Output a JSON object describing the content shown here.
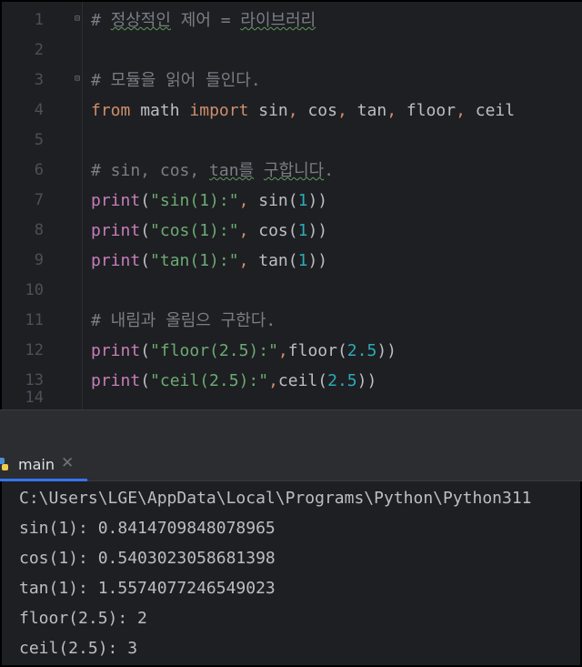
{
  "editor": {
    "lines": [
      {
        "n": "1",
        "html": "<span class=\"cmt\"># <span class=\"typo\">정상적인</span> 제어 = <span class=\"typo\">라이브러리</span></span>"
      },
      {
        "n": "2",
        "html": ""
      },
      {
        "n": "3",
        "html": "<span class=\"cmt\"># 모듈을 읽어 들인다.</span>"
      },
      {
        "n": "4",
        "html": "<span class=\"kw\">from</span> math <span class=\"kw\">import</span> sin<span class=\"punc\">,</span> cos<span class=\"punc\">,</span> tan<span class=\"punc\">,</span> floor<span class=\"punc\">,</span> ceil"
      },
      {
        "n": "5",
        "html": ""
      },
      {
        "n": "6",
        "html": "<span class=\"cmt\"># sin, cos, <span class=\"typo\">tan를</span> <span class=\"typo\">구합니다</span>.</span>"
      },
      {
        "n": "7",
        "html": "<span class=\"fn\">print</span>(<span class=\"str\">\"sin(1):\"</span><span class=\"punc\">,</span> sin(<span class=\"num\">1</span>))"
      },
      {
        "n": "8",
        "html": "<span class=\"fn\">print</span>(<span class=\"str\">\"cos(1):\"</span><span class=\"punc\">,</span> cos(<span class=\"num\">1</span>))"
      },
      {
        "n": "9",
        "html": "<span class=\"fn\">print</span>(<span class=\"str\">\"tan(1):\"</span><span class=\"punc\">,</span> tan(<span class=\"num\">1</span>))"
      },
      {
        "n": "10",
        "html": ""
      },
      {
        "n": "11",
        "html": "<span class=\"cmt\"># 내림과 올림으 구한다.</span>"
      },
      {
        "n": "12",
        "html": "<span class=\"fn\">print</span>(<span class=\"str\">\"floor(2.5):\"</span><span class=\"punc\">,</span>floor(<span class=\"num\">2.5</span>))"
      },
      {
        "n": "13",
        "html": "<span class=\"fn\">print</span>(<span class=\"str\">\"ceil(2.5):\"</span><span class=\"punc\">,</span>ceil(<span class=\"num\">2.5</span>))"
      },
      {
        "n": "14",
        "html": ""
      }
    ],
    "fold_marker": "⊟"
  },
  "run_panel": {
    "tab_label": "main",
    "tab_close": "✕",
    "icon": "python-icon",
    "output": [
      "C:\\Users\\LGE\\AppData\\Local\\Programs\\Python\\Python311",
      "sin(1): 0.8414709848078965",
      "cos(1): 0.5403023058681398",
      "tan(1): 1.5574077246549023",
      "floor(2.5): 2",
      "ceil(2.5): 3"
    ]
  },
  "colors": {
    "background": "#1e1f22",
    "keyword": "#cf8e6d",
    "string": "#6aab73",
    "number": "#2aacb8",
    "builtin": "#c77dbb",
    "comment": "#7a7e85",
    "tab_accent": "#3574f0"
  }
}
